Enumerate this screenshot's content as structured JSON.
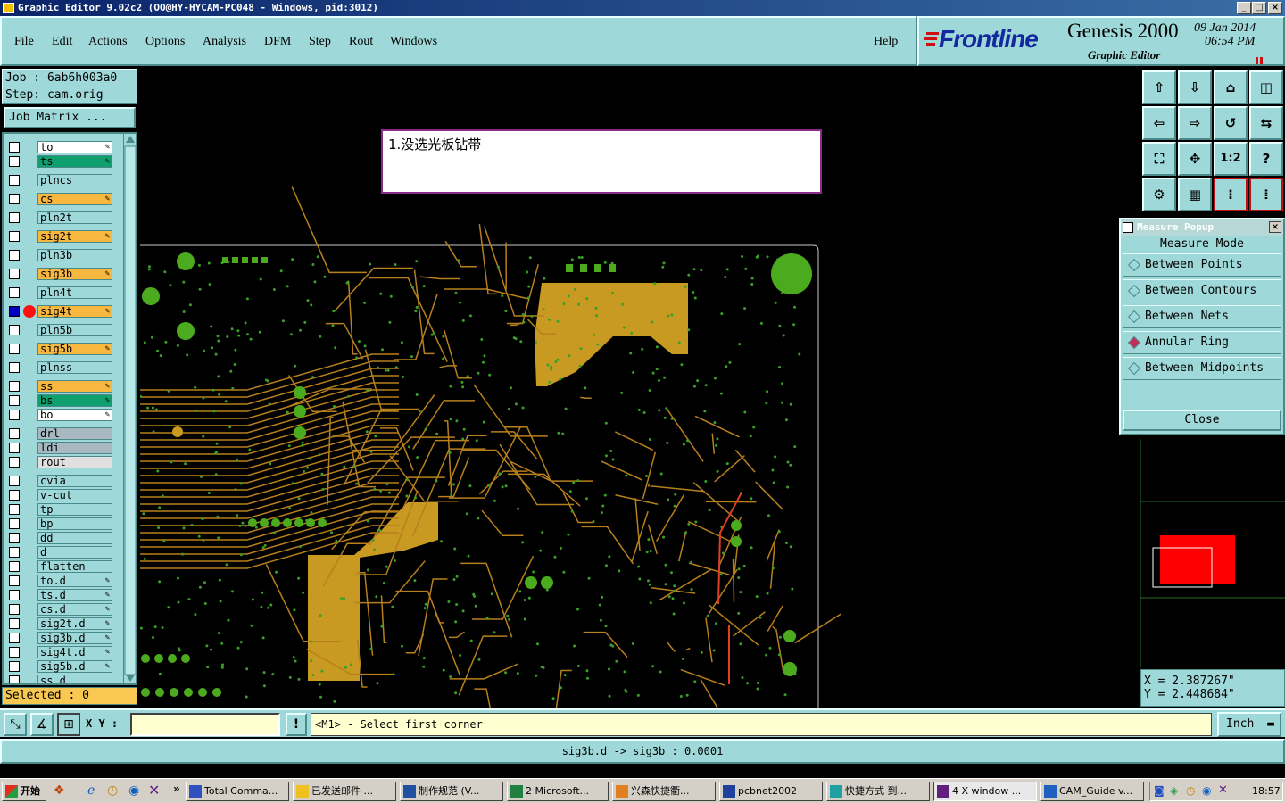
{
  "window": {
    "title": "Graphic Editor 9.02c2  (OO@HY-HYCAM-PC048 - Windows, pid:3012)"
  },
  "menu": {
    "items": [
      "File",
      "Edit",
      "Actions",
      "Options",
      "Analysis",
      "DFM",
      "Step",
      "Rout",
      "Windows"
    ],
    "help": "Help"
  },
  "brand": {
    "logo": "Frontline",
    "product": "Genesis 2000",
    "subtitle": "Graphic Editor",
    "date": "09 Jan 2014",
    "time": "06:54 PM"
  },
  "job": {
    "job_label": "Job : 6ab6h003a0",
    "step_label": "Step: cam.orig",
    "matrix_button": "Job Matrix ..."
  },
  "layers": [
    {
      "name": "to",
      "color": "#ffffff",
      "edit": true,
      "checked": false
    },
    {
      "name": "ts",
      "color": "#10a070",
      "edit": true,
      "checked": false
    },
    {
      "name": "plncs",
      "color": "#9fd8d8",
      "edit": false,
      "checked": false
    },
    {
      "name": "cs",
      "color": "#f8b840",
      "edit": true,
      "checked": false
    },
    {
      "name": "pln2t",
      "color": "#9fd8d8",
      "edit": false,
      "checked": false
    },
    {
      "name": "sig2t",
      "color": "#f8b840",
      "edit": true,
      "checked": false
    },
    {
      "name": "pln3b",
      "color": "#9fd8d8",
      "edit": false,
      "checked": false
    },
    {
      "name": "sig3b",
      "color": "#f8b840",
      "edit": true,
      "checked": false
    },
    {
      "name": "pln4t",
      "color": "#9fd8d8",
      "edit": false,
      "checked": false
    },
    {
      "name": "sig4t",
      "color": "#f8b840",
      "edit": true,
      "checked": true,
      "active": true
    },
    {
      "name": "pln5b",
      "color": "#9fd8d8",
      "edit": false,
      "checked": false
    },
    {
      "name": "sig5b",
      "color": "#f8b840",
      "edit": true,
      "checked": false
    },
    {
      "name": "plnss",
      "color": "#9fd8d8",
      "edit": false,
      "checked": false
    },
    {
      "name": "ss",
      "color": "#f8b840",
      "edit": true,
      "checked": false
    },
    {
      "name": "bs",
      "color": "#10a070",
      "edit": true,
      "checked": false
    },
    {
      "name": "bo",
      "color": "#ffffff",
      "edit": true,
      "checked": false
    },
    {
      "name": "drl",
      "color": "#a8b8c0",
      "edit": false,
      "checked": false
    },
    {
      "name": "ldi",
      "color": "#a8b8c0",
      "edit": false,
      "checked": false
    },
    {
      "name": "rout",
      "color": "#e0e0e0",
      "edit": false,
      "checked": false
    },
    {
      "name": "cvia",
      "color": "#9fd8d8",
      "edit": false,
      "checked": false
    },
    {
      "name": "v-cut",
      "color": "#9fd8d8",
      "edit": false,
      "checked": false
    },
    {
      "name": "tp",
      "color": "#9fd8d8",
      "edit": false,
      "checked": false
    },
    {
      "name": "bp",
      "color": "#9fd8d8",
      "edit": false,
      "checked": false
    },
    {
      "name": "dd",
      "color": "#9fd8d8",
      "edit": false,
      "checked": false
    },
    {
      "name": "d",
      "color": "#9fd8d8",
      "edit": false,
      "checked": false
    },
    {
      "name": "flatten",
      "color": "#9fd8d8",
      "edit": false,
      "checked": false
    },
    {
      "name": "to.d",
      "color": "#9fd8d8",
      "edit": true,
      "checked": false
    },
    {
      "name": "ts.d",
      "color": "#9fd8d8",
      "edit": true,
      "checked": false
    },
    {
      "name": "cs.d",
      "color": "#9fd8d8",
      "edit": true,
      "checked": false
    },
    {
      "name": "sig2t.d",
      "color": "#9fd8d8",
      "edit": true,
      "checked": false
    },
    {
      "name": "sig3b.d",
      "color": "#9fd8d8",
      "edit": true,
      "checked": false
    },
    {
      "name": "sig4t.d",
      "color": "#9fd8d8",
      "edit": true,
      "checked": false
    },
    {
      "name": "sig5b.d",
      "color": "#9fd8d8",
      "edit": true,
      "checked": false
    },
    {
      "name": "ss.d",
      "color": "#9fd8d8",
      "edit": false,
      "checked": false
    }
  ],
  "selected": "Selected : 0",
  "note": "1.没选光板钻带",
  "measure": {
    "title": "Measure Popup",
    "heading": "Measure Mode",
    "options": [
      "Between Points",
      "Between Contours",
      "Between Nets",
      "Annular Ring",
      "Between Midpoints"
    ],
    "selected": "Annular Ring",
    "close": "Close"
  },
  "tools": {
    "scale_label": "1:2"
  },
  "coords": {
    "x": "X = 2.387267\"",
    "y": "Y = 2.448684\""
  },
  "command": {
    "xy_label": "X Y :",
    "prompt": "<M1> - Select first corner",
    "units": "Inch"
  },
  "status": "sig3b.d -> sig3b : 0.0001",
  "taskbar": {
    "start": "开始",
    "tasks": [
      "Total Comma...",
      "已发送邮件 ...",
      "制作规范 (V...",
      "2 Microsoft...",
      "兴森快捷衢...",
      "pcbnet2002",
      "快捷方式 到...",
      "4 X window ...",
      "CAM_Guide v..."
    ],
    "clock": "18:57"
  },
  "colors": {
    "panel": "#9fd8d8",
    "copper": "#c89a22",
    "pad": "#4caa1e",
    "trace": "#b8801c"
  }
}
